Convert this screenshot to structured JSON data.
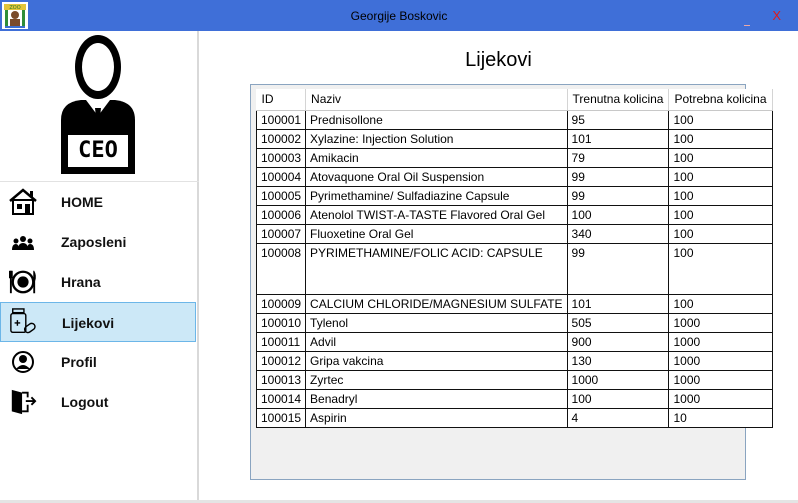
{
  "window": {
    "title": "Georgije Boskovic",
    "close_label": "X"
  },
  "logo": {
    "badge_text": "CEO"
  },
  "sidebar": {
    "items": [
      {
        "label": "HOME",
        "icon": "home-icon"
      },
      {
        "label": "Zaposleni",
        "icon": "people-icon"
      },
      {
        "label": "Hrana",
        "icon": "food-plate-icon"
      },
      {
        "label": "Lijekovi",
        "icon": "medicine-icon",
        "active": true
      },
      {
        "label": "Profil",
        "icon": "user-icon"
      },
      {
        "label": "Logout",
        "icon": "logout-door-icon"
      }
    ]
  },
  "main": {
    "title": "Lijekovi",
    "columns": [
      "ID",
      "Naziv",
      "Trenutna kolicina",
      "Potrebna kolicina"
    ],
    "rows": [
      [
        "100001",
        "Prednisollone",
        "95",
        "100"
      ],
      [
        "100002",
        "Xylazine: Injection Solution",
        "101",
        "100"
      ],
      [
        "100003",
        "Amikacin",
        "79",
        "100"
      ],
      [
        "100004",
        "Atovaquone Oral Oil Suspension",
        "99",
        "100"
      ],
      [
        "100005",
        "Pyrimethamine/ Sulfadiazine Capsule",
        "99",
        "100"
      ],
      [
        "100006",
        "Atenolol TWIST-A-TASTE Flavored Oral Gel",
        "100",
        "100"
      ],
      [
        "100007",
        "Fluoxetine Oral Gel",
        "340",
        "100"
      ],
      [
        "100008",
        "PYRIMETHAMINE/FOLIC ACID: CAPSULE",
        "99",
        "100"
      ],
      [
        "100009",
        "CALCIUM CHLORIDE/MAGNESIUM SULFATE",
        "101",
        "100"
      ],
      [
        "100010",
        "Tylenol",
        "505",
        "1000"
      ],
      [
        "100011",
        "Advil",
        "900",
        "1000"
      ],
      [
        "100012",
        "Gripa vakcina",
        "130",
        "1000"
      ],
      [
        "100013",
        "Zyrtec",
        "1000",
        "1000"
      ],
      [
        "100014",
        "Benadryl",
        "100",
        "1000"
      ],
      [
        "100015",
        "Aspirin",
        "4",
        "10"
      ]
    ]
  },
  "colors": {
    "titlebar": "#3f6fd8",
    "active_nav_bg": "#cce8f7",
    "active_nav_border": "#6cb6e8",
    "close": "#e01a1a"
  }
}
